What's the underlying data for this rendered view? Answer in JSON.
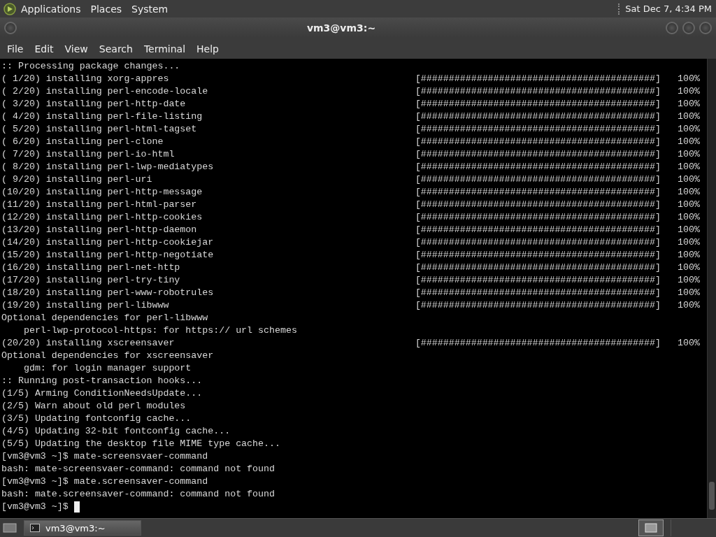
{
  "top_panel": {
    "menus": [
      "Applications",
      "Places",
      "System"
    ],
    "clock": "Sat Dec 7, 4:34 PM"
  },
  "window": {
    "title": "vm3@vm3:~"
  },
  "menu_bar": [
    "File",
    "Edit",
    "View",
    "Search",
    "Terminal",
    "Help"
  ],
  "terminal": {
    "lines": [
      {
        "text": ":: Processing package changes..."
      },
      {
        "text": "( 1/20) installing xorg-appres",
        "bar": "[##########################################]",
        "percent": "100%"
      },
      {
        "text": "( 2/20) installing perl-encode-locale",
        "bar": "[##########################################]",
        "percent": "100%"
      },
      {
        "text": "( 3/20) installing perl-http-date",
        "bar": "[##########################################]",
        "percent": "100%"
      },
      {
        "text": "( 4/20) installing perl-file-listing",
        "bar": "[##########################################]",
        "percent": "100%"
      },
      {
        "text": "( 5/20) installing perl-html-tagset",
        "bar": "[##########################################]",
        "percent": "100%"
      },
      {
        "text": "( 6/20) installing perl-clone",
        "bar": "[##########################################]",
        "percent": "100%"
      },
      {
        "text": "( 7/20) installing perl-io-html",
        "bar": "[##########################################]",
        "percent": "100%"
      },
      {
        "text": "( 8/20) installing perl-lwp-mediatypes",
        "bar": "[##########################################]",
        "percent": "100%"
      },
      {
        "text": "( 9/20) installing perl-uri",
        "bar": "[##########################################]",
        "percent": "100%"
      },
      {
        "text": "(10/20) installing perl-http-message",
        "bar": "[##########################################]",
        "percent": "100%"
      },
      {
        "text": "(11/20) installing perl-html-parser",
        "bar": "[##########################################]",
        "percent": "100%"
      },
      {
        "text": "(12/20) installing perl-http-cookies",
        "bar": "[##########################################]",
        "percent": "100%"
      },
      {
        "text": "(13/20) installing perl-http-daemon",
        "bar": "[##########################################]",
        "percent": "100%"
      },
      {
        "text": "(14/20) installing perl-http-cookiejar",
        "bar": "[##########################################]",
        "percent": "100%"
      },
      {
        "text": "(15/20) installing perl-http-negotiate",
        "bar": "[##########################################]",
        "percent": "100%"
      },
      {
        "text": "(16/20) installing perl-net-http",
        "bar": "[##########################################]",
        "percent": "100%"
      },
      {
        "text": "(17/20) installing perl-try-tiny",
        "bar": "[##########################################]",
        "percent": "100%"
      },
      {
        "text": "(18/20) installing perl-www-robotrules",
        "bar": "[##########################################]",
        "percent": "100%"
      },
      {
        "text": "(19/20) installing perl-libwww",
        "bar": "[##########################################]",
        "percent": "100%"
      },
      {
        "text": "Optional dependencies for perl-libwww"
      },
      {
        "text": "    perl-lwp-protocol-https: for https:// url schemes"
      },
      {
        "text": "(20/20) installing xscreensaver",
        "bar": "[##########################################]",
        "percent": "100%"
      },
      {
        "text": "Optional dependencies for xscreensaver"
      },
      {
        "text": "    gdm: for login manager support"
      },
      {
        "text": ":: Running post-transaction hooks..."
      },
      {
        "text": "(1/5) Arming ConditionNeedsUpdate..."
      },
      {
        "text": "(2/5) Warn about old perl modules"
      },
      {
        "text": "(3/5) Updating fontconfig cache..."
      },
      {
        "text": "(4/5) Updating 32-bit fontconfig cache..."
      },
      {
        "text": "(5/5) Updating the desktop file MIME type cache..."
      },
      {
        "text": "[vm3@vm3 ~]$ mate-screensvaer-command"
      },
      {
        "text": "bash: mate-screensvaer-command: command not found"
      },
      {
        "text": "[vm3@vm3 ~]$ mate.screensaver-command"
      },
      {
        "text": "bash: mate.screensaver-command: command not found"
      },
      {
        "text": "[vm3@vm3 ~]$ ",
        "cursor": true
      }
    ]
  },
  "taskbar": {
    "tasks": [
      {
        "label": "vm3@vm3:~",
        "selected": true
      }
    ]
  }
}
